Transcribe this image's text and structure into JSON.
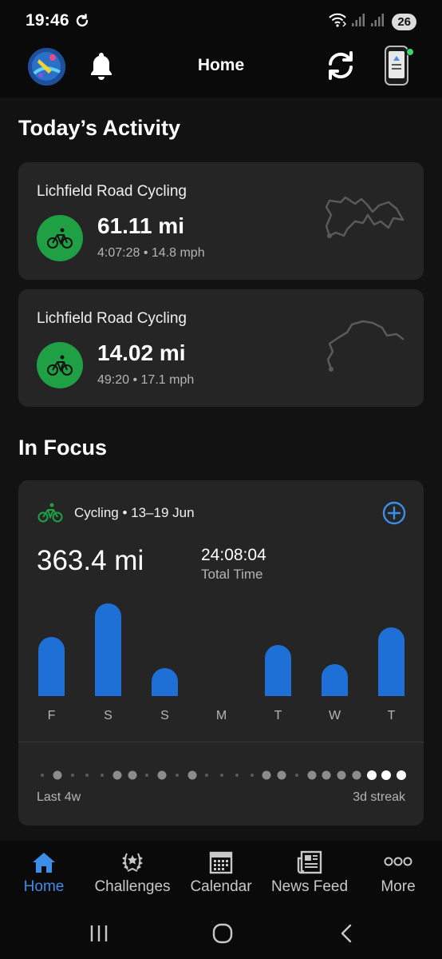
{
  "status_bar": {
    "time": "19:46",
    "battery": "26"
  },
  "header": {
    "title": "Home"
  },
  "todays_activity": {
    "title": "Today’s Activity",
    "items": [
      {
        "name": "Lichfield Road Cycling",
        "distance": "61.11 mi",
        "meta": "4:07:28 • 14.8 mph"
      },
      {
        "name": "Lichfield Road Cycling",
        "distance": "14.02 mi",
        "meta": "49:20 • 17.1 mph"
      }
    ]
  },
  "in_focus": {
    "title": "In Focus",
    "header": "Cycling • 13–19 Jun",
    "total_distance": "363.4 mi",
    "total_time": "24:08:04",
    "total_time_label": "Total Time",
    "chart_data": {
      "type": "bar",
      "categories": [
        "F",
        "S",
        "S",
        "M",
        "T",
        "W",
        "T"
      ],
      "values": [
        74,
        116,
        35,
        0,
        64,
        40,
        86
      ],
      "bar_color": "#1e6fd6"
    },
    "streak": {
      "left_label": "Last 4w",
      "right_label": "3d streak",
      "days": [
        0,
        1,
        0,
        0,
        0,
        1,
        1,
        0,
        1,
        0,
        1,
        0,
        0,
        0,
        0,
        1,
        1,
        0,
        1,
        1,
        1,
        1,
        2,
        2,
        2
      ],
      "colors": {
        "inactive": "#5a5a5a",
        "active": "#8c8c8c",
        "streak": "#ffffff"
      }
    }
  },
  "bottom_nav": [
    {
      "label": "Home",
      "icon": "home-icon",
      "active": true
    },
    {
      "label": "Challenges",
      "icon": "laurel-icon",
      "active": false
    },
    {
      "label": "Calendar",
      "icon": "calendar-icon",
      "active": false
    },
    {
      "label": "News Feed",
      "icon": "newspaper-icon",
      "active": false
    },
    {
      "label": "More",
      "icon": "more-dots-icon",
      "active": false
    }
  ],
  "colors": {
    "accent": "#3b8eea",
    "activity_green": "#1fa045",
    "card": "#252525",
    "background": "#121212"
  }
}
